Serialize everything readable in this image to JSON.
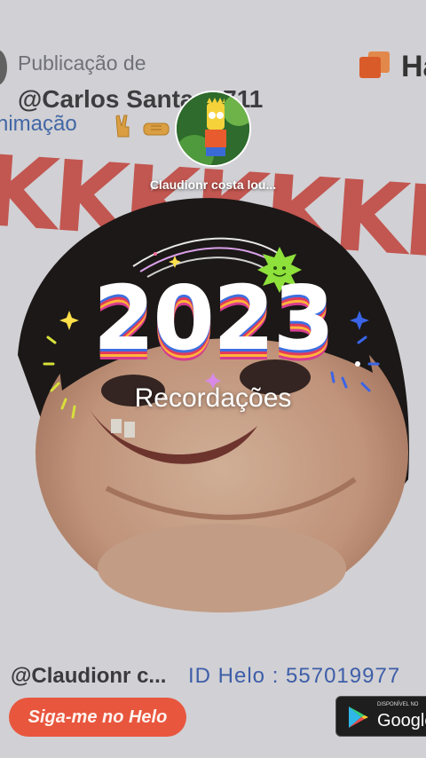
{
  "background_post": {
    "published_by_label": "Publicação de",
    "brand_text": "Ha",
    "author_handle": "@Carlos Santana711",
    "caption": "nimação",
    "meme_text": "KKKKKKK"
  },
  "profile": {
    "name": "Claudionr costa lou..."
  },
  "recap": {
    "year": "2023",
    "subtitle": "Recordações"
  },
  "footer": {
    "user_handle": "@Claudionr c...",
    "id_label": "ID Helo :  557019977",
    "follow_button": "Siga-me no Helo",
    "store_small": "DISPONÍVEL NO",
    "store_big": "Google"
  },
  "colors": {
    "follow_button": "#e8563e",
    "caption_blue": "#4a73b8",
    "year_stripe_1": "#3d6fe0",
    "year_stripe_2": "#e23b5c",
    "year_stripe_3": "#ffb43a"
  },
  "icons": [
    "victory-hand-emoji-icon",
    "handshake-emoji-icon",
    "helo-logo-icon",
    "google-play-icon",
    "sparkle-icon",
    "smiley-star-icon"
  ]
}
